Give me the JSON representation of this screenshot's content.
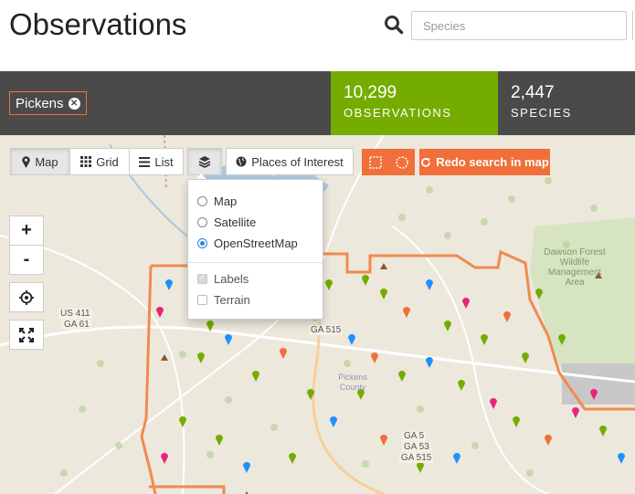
{
  "header": {
    "title": "Observations",
    "search_placeholder": "Species"
  },
  "stats": {
    "place": "Pickens",
    "observations_count": "10,299",
    "observations_label": "OBSERVATIONS",
    "species_count": "2,447",
    "species_label": "SPECIES"
  },
  "toolbar": {
    "map_label": "Map",
    "grid_label": "Grid",
    "list_label": "List",
    "places_label": "Places of Interest",
    "redo_label": "Redo search in map"
  },
  "layers_menu": {
    "options": [
      "Map",
      "Satellite",
      "OpenStreetMap"
    ],
    "selected": "OpenStreetMap",
    "labels_label": "Labels",
    "terrain_label": "Terrain"
  },
  "map_controls": {
    "zoom_in": "+",
    "zoom_out": "-"
  },
  "map_labels": {
    "route_us411": "US 411",
    "route_ga61": "GA 61",
    "route_ga515_top": "GA 515",
    "county": "Pickens County",
    "route_ga5": "GA 5",
    "route_ga53": "GA 53",
    "route_ga515_bottom": "GA 515",
    "forest": "Dawson Forest Wildlife Management Area"
  },
  "colors": {
    "accent_green": "#74ac00",
    "accent_orange": "#f16f3a",
    "statbar": "#4a4a4a",
    "selected_radio": "#2b7fd8"
  }
}
